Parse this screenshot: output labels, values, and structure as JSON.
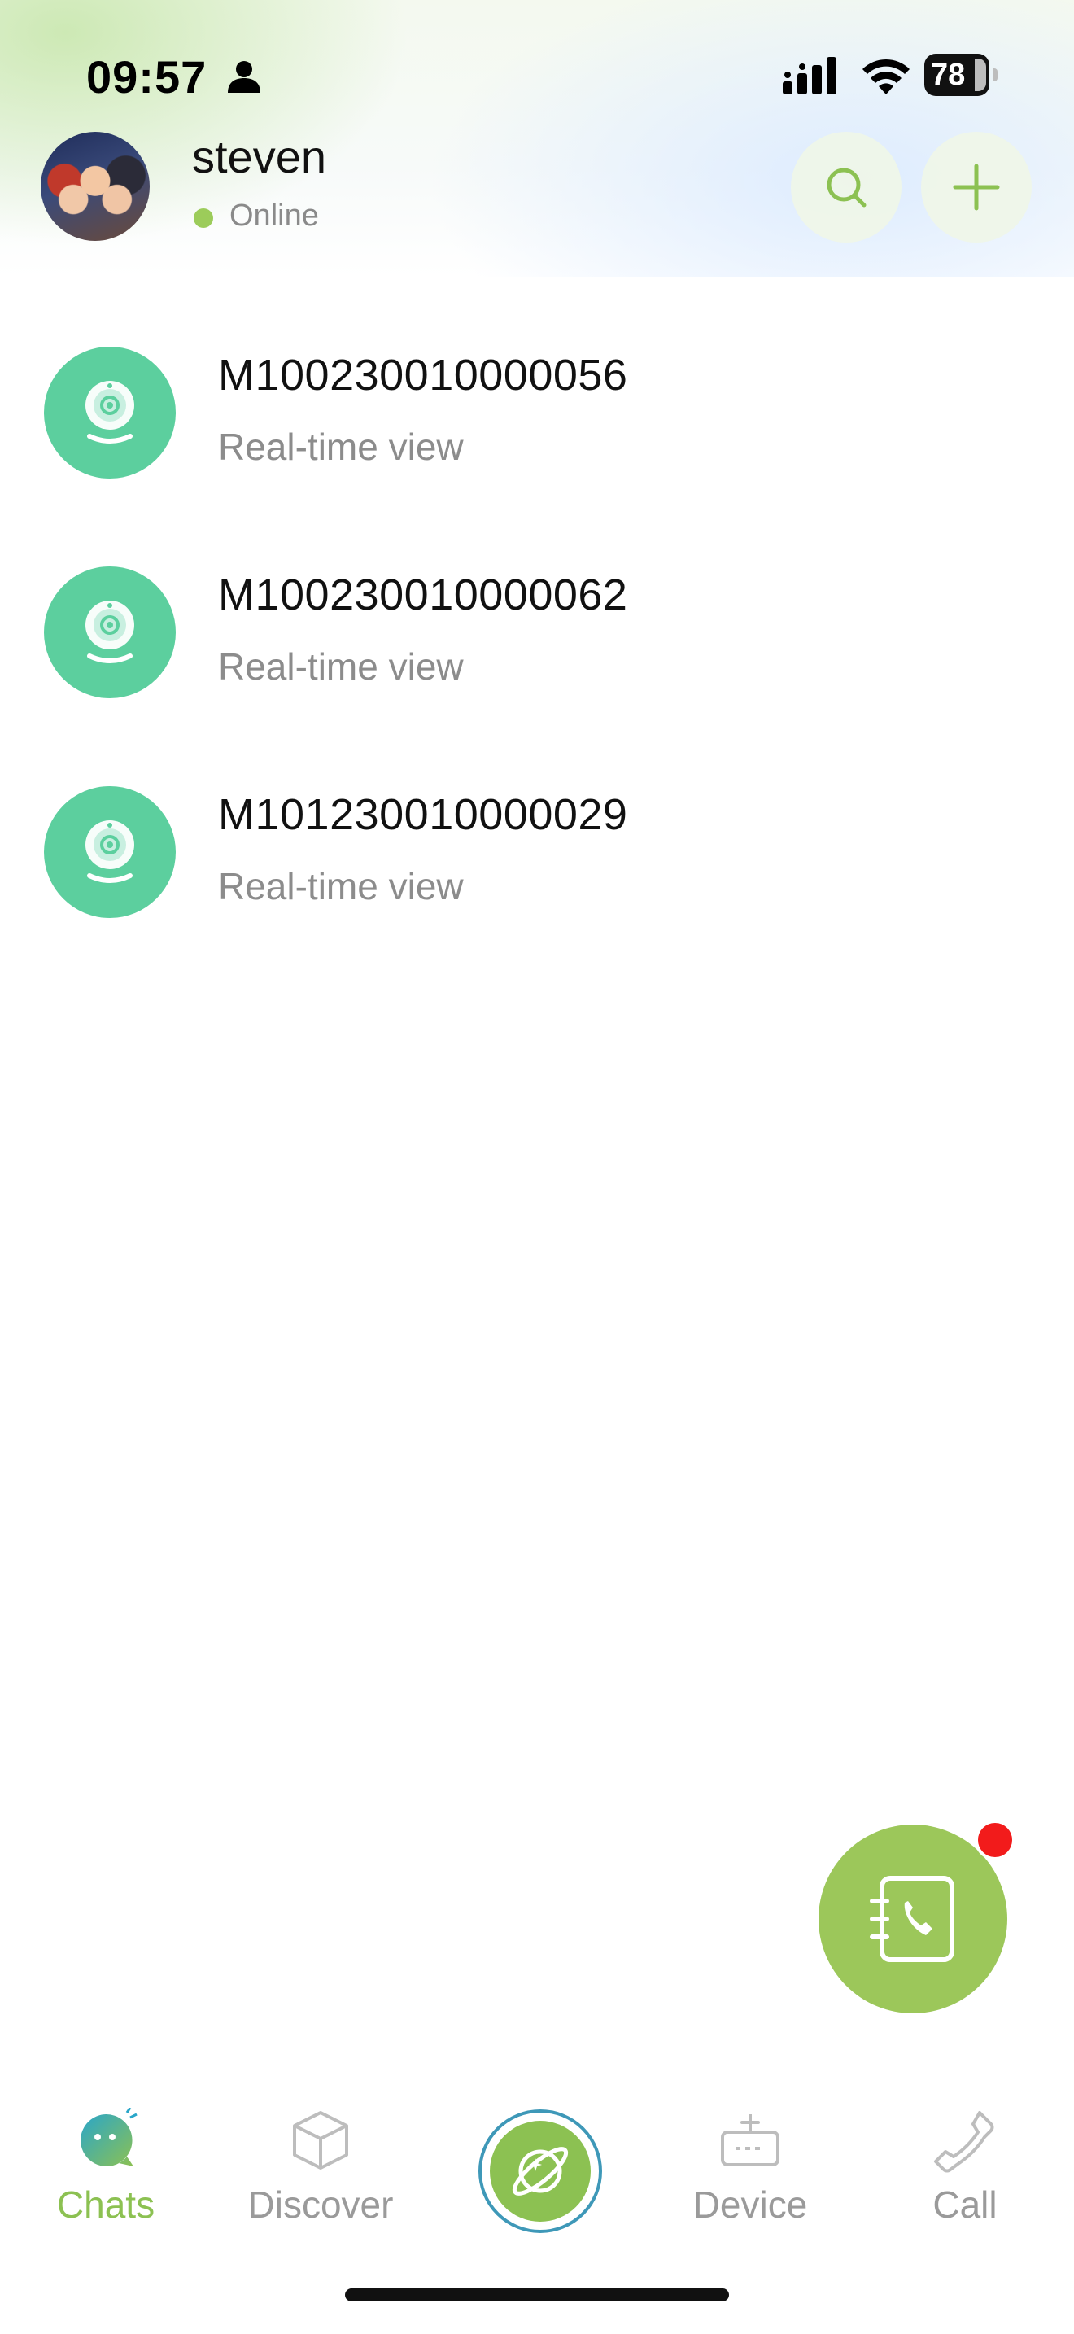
{
  "status_bar": {
    "time": "09:57",
    "battery": "78"
  },
  "header": {
    "username": "steven",
    "status": "Online"
  },
  "devices": [
    {
      "id": "M100230010000056",
      "subtitle": "Real-time view"
    },
    {
      "id": "M100230010000062",
      "subtitle": "Real-time view"
    },
    {
      "id": "M101230010000029",
      "subtitle": "Real-time view"
    }
  ],
  "tabs": [
    {
      "label": "Chats",
      "icon": "chat-bubble-icon",
      "active": true
    },
    {
      "label": "Discover",
      "icon": "cube-icon",
      "active": false
    },
    {
      "label": "",
      "icon": "planet-icon",
      "active": false
    },
    {
      "label": "Device",
      "icon": "device-icon",
      "active": false
    },
    {
      "label": "Call",
      "icon": "phone-icon",
      "active": false
    }
  ],
  "colors": {
    "accent": "#8cc152",
    "device_icon_bg": "#5ccf9e",
    "fab": "#9cc75a",
    "badge": "#f21b1b"
  }
}
